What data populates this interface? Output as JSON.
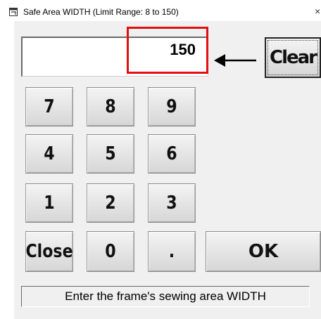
{
  "window": {
    "title": "Safe Area WIDTH    (Limit Range: 8 to 150)",
    "close_glyph": "×"
  },
  "display": {
    "value": "150",
    "highlight_color": "#e01010",
    "arrow_icon": "left-arrow-icon"
  },
  "buttons": {
    "clear": "Clear",
    "seven": "7",
    "eight": "8",
    "nine": "9",
    "four": "4",
    "five": "5",
    "six": "6",
    "one": "1",
    "two": "2",
    "three": "3",
    "close": "Close",
    "zero": "0",
    "dot": ".",
    "ok": "OK"
  },
  "status": {
    "message": "Enter the frame's sewing area WIDTH"
  }
}
